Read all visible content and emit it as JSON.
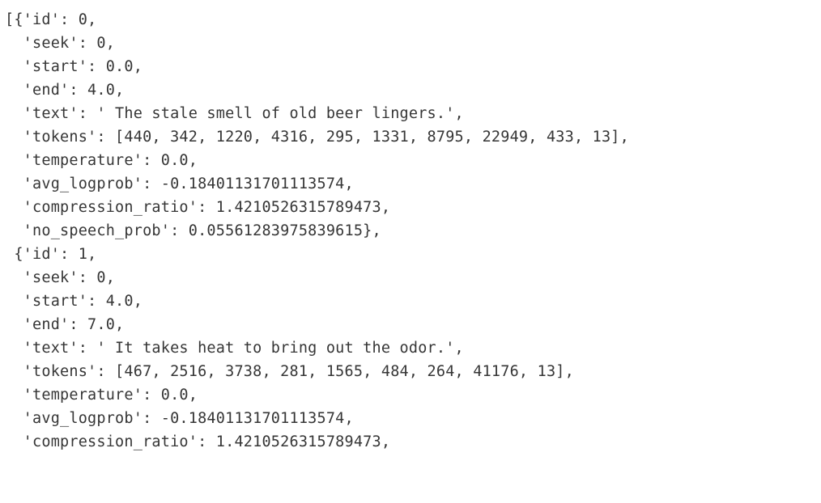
{
  "lines": [
    "[{'id': 0,",
    "  'seek': 0,",
    "  'start': 0.0,",
    "  'end': 4.0,",
    "  'text': ' The stale smell of old beer lingers.',",
    "  'tokens': [440, 342, 1220, 4316, 295, 1331, 8795, 22949, 433, 13],",
    "  'temperature': 0.0,",
    "  'avg_logprob': -0.18401131701113574,",
    "  'compression_ratio': 1.4210526315789473,",
    "  'no_speech_prob': 0.05561283975839615},",
    " {'id': 1,",
    "  'seek': 0,",
    "  'start': 4.0,",
    "  'end': 7.0,",
    "  'text': ' It takes heat to bring out the odor.',",
    "  'tokens': [467, 2516, 3738, 281, 1565, 484, 264, 41176, 13],",
    "  'temperature': 0.0,",
    "  'avg_logprob': -0.18401131701113574,",
    "  'compression_ratio': 1.4210526315789473,"
  ]
}
